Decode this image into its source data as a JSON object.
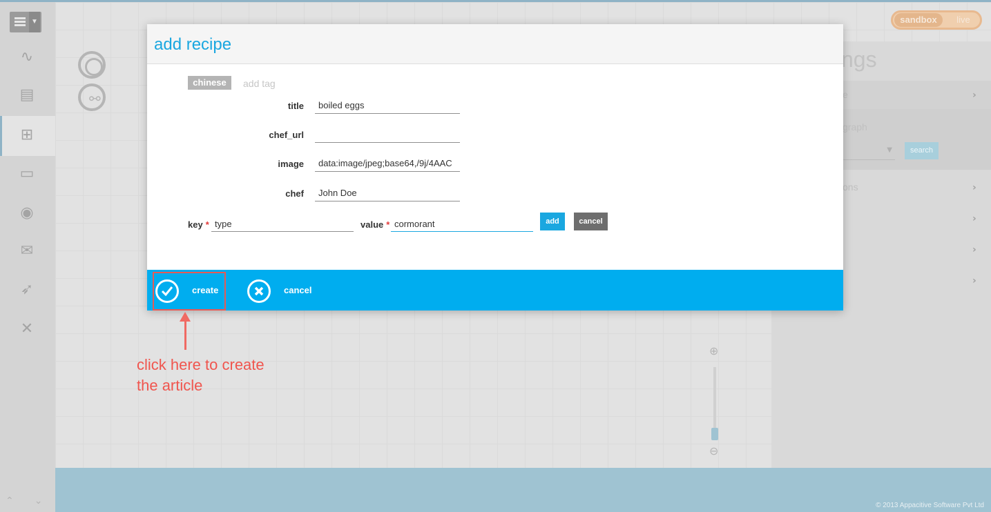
{
  "app": {
    "env_toggle": {
      "active": "sandbox",
      "inactive": "live"
    },
    "footer_copyright": "© 2013 Appacitive Software Pvt Ltd",
    "right_panel": {
      "title_fragment": "ngs",
      "row1_fragment": "e",
      "subsection_fragment": "graph",
      "search_label": "search",
      "row2_fragment": "ons"
    },
    "sidebar_icons": [
      "pulse-icon",
      "data-icon",
      "hierarchy-icon",
      "console-icon",
      "broadcast-icon",
      "mail-icon",
      "rocket-icon",
      "tools-icon"
    ]
  },
  "modal": {
    "title": "add recipe",
    "tags": [
      "chinese"
    ],
    "add_tag_label": "add tag",
    "fields": [
      {
        "label": "title",
        "value": "boiled eggs"
      },
      {
        "label": "chef_url",
        "value": ""
      },
      {
        "label": "image",
        "value": "data:image/jpeg;base64,/9j/4AAC"
      },
      {
        "label": "chef",
        "value": "John Doe"
      }
    ],
    "key_label": "key",
    "key_value": "type",
    "value_label": "value",
    "value_value": "cormorant",
    "required_mark": "*",
    "add_label": "add",
    "cancel_small_label": "cancel",
    "create_label": "create",
    "cancel_label": "cancel"
  },
  "annotation": {
    "text_line1": "click here to create",
    "text_line2": "the article",
    "color": "#f0554e"
  },
  "colors": {
    "accent": "#00adef",
    "title": "#1aa7e0",
    "highlight": "#e85a55"
  }
}
